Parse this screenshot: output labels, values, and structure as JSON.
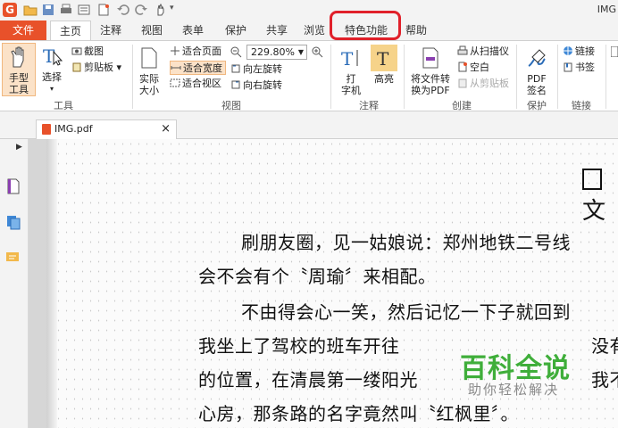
{
  "app": {
    "title": "IMG"
  },
  "tabs": [
    {
      "label": "文件"
    },
    {
      "label": "主页"
    },
    {
      "label": "注释"
    },
    {
      "label": "视图"
    },
    {
      "label": "表单"
    },
    {
      "label": "保护"
    },
    {
      "label": "共享"
    },
    {
      "label": "浏览"
    },
    {
      "label": "特色功能"
    },
    {
      "label": "帮助"
    }
  ],
  "ribbon": {
    "tools": {
      "hand": "手型\n工具",
      "select": "选择",
      "screenshot": "截图",
      "clipboard": "剪贴板",
      "group": "工具"
    },
    "view": {
      "actual": "实际\n大小",
      "fit_page": "适合页面",
      "fit_width": "适合宽度",
      "fit_visible": "适合视区",
      "zoom": "229.80%",
      "rotate_left": "向左旋转",
      "rotate_right": "向右旋转",
      "group": "视图"
    },
    "annot": {
      "typewriter": "打\n字机",
      "highlight": "高亮",
      "group": "注释"
    },
    "create": {
      "convert": "将文件转\n换为PDF",
      "from_scanner": "从扫描仪",
      "blank": "空白",
      "from_clipboard": "从剪贴板",
      "group": "创建"
    },
    "protect": {
      "sign": "PDF\n签名",
      "group": "保护"
    },
    "links": {
      "link": "链接",
      "bookmark": "书签",
      "group": "链接"
    }
  },
  "document": {
    "tab_name": "IMG.pdf",
    "close": "×",
    "heading": "文",
    "lines": [
      "刷朋友圈，见一姑娘说：郑州地铁二号线",
      "会不会有个〝周瑜〞来相配。",
      "不由得会心一笑，然后记忆一下子就回到",
      "我坐上了驾校的班车开往",
      "没有",
      "的位置，在清晨第一缕阳光",
      "我不",
      "心房，那条路的名字竟然叫〝红枫里〞。"
    ]
  },
  "watermark": {
    "title": "百科全说",
    "subtitle": "助你轻松解决"
  },
  "colors": {
    "brand": "#e8512a",
    "highlight_box": "#e0202a",
    "watermark": "#3fae3a"
  }
}
